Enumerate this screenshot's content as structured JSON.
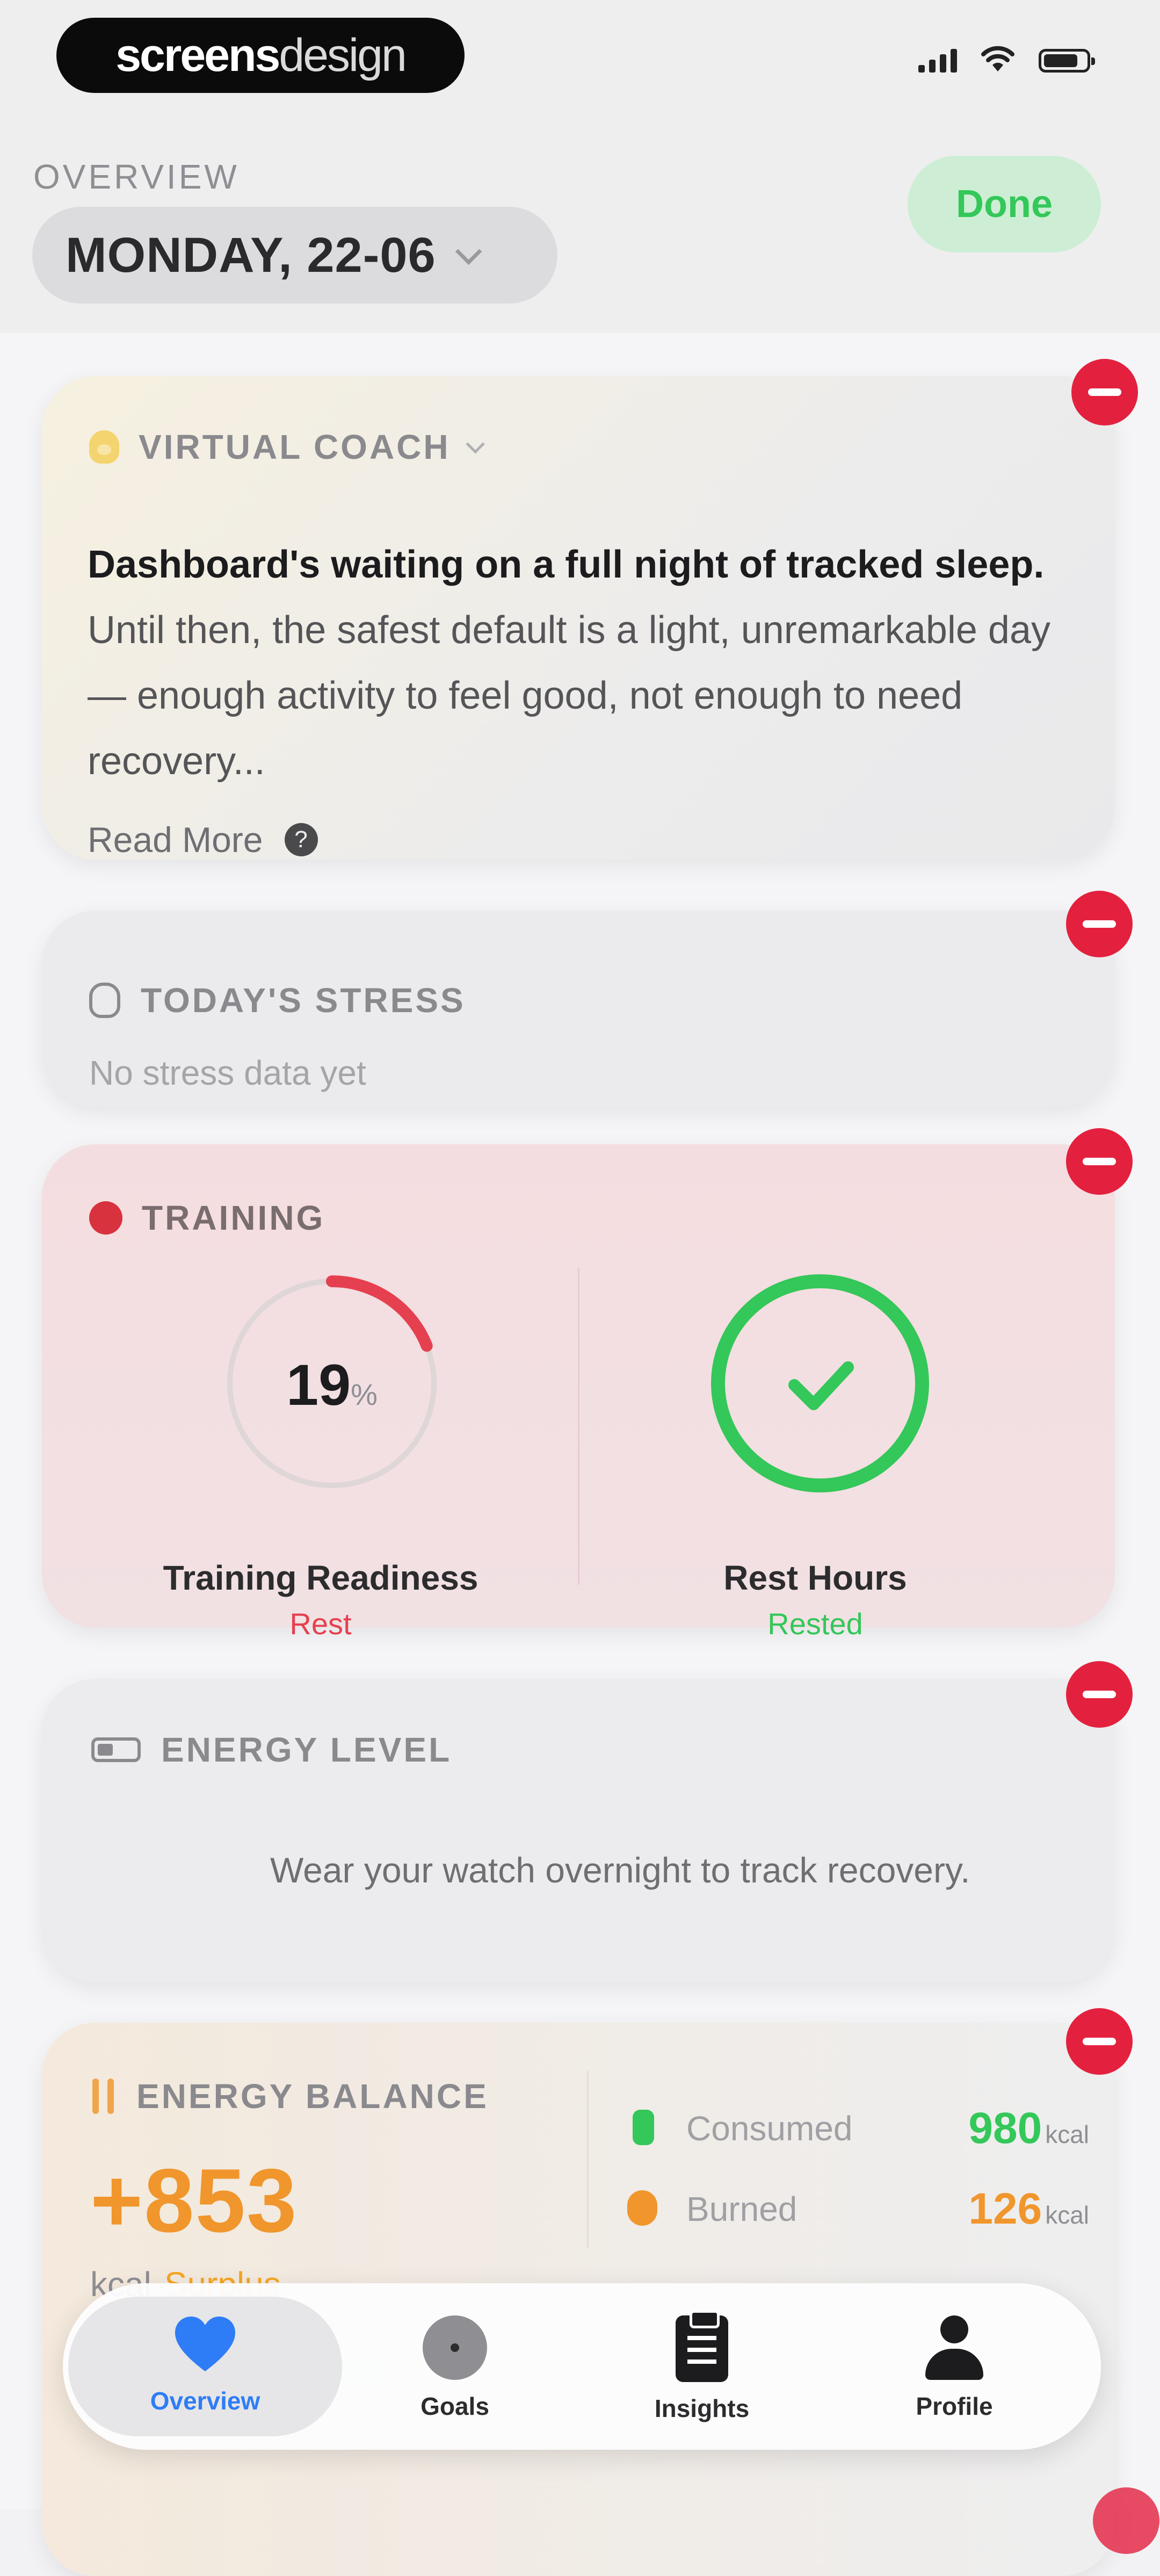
{
  "brand": {
    "bold": "screens",
    "light": "design"
  },
  "header": {
    "overview_label": "OVERVIEW",
    "date": "MONDAY, 22-06",
    "done_label": "Done"
  },
  "coach": {
    "title": "VIRTUAL COACH",
    "bold_text": "Dashboard's waiting on a full night of tracked sleep.",
    "body_text": " Until then, the safest default is a light, unremarkable day — enough activity to feel good, not enough to need recovery...",
    "read_more": "Read More",
    "info_glyph": "?"
  },
  "stress": {
    "title": "TODAY'S STRESS",
    "subtitle": "No stress data yet"
  },
  "training": {
    "title": "TRAINING",
    "readiness": {
      "value": "19",
      "unit": "%",
      "fraction": 0.19,
      "label": "Training Readiness",
      "status": "Rest",
      "color": "#e5404f"
    },
    "rest_hours": {
      "label": "Rest Hours",
      "status": "Rested",
      "color": "#34c759"
    }
  },
  "energy_level": {
    "title": "ENERGY LEVEL",
    "message": "Wear your watch overnight to track recovery."
  },
  "energy_balance": {
    "title": "ENERGY BALANCE",
    "net": "+853",
    "unit": "kcal",
    "state": "Surplus",
    "consumed": {
      "label": "Consumed",
      "value": "980",
      "unit": "kcal",
      "color": "#34c759"
    },
    "burned": {
      "label": "Burned",
      "value": "126",
      "unit": "kcal",
      "color": "#f0962c"
    }
  },
  "tabs": [
    {
      "label": "Overview",
      "icon": "heart-icon",
      "active": true
    },
    {
      "label": "Goals",
      "icon": "goal-icon",
      "active": false
    },
    {
      "label": "Insights",
      "icon": "clipboard-icon",
      "active": false
    },
    {
      "label": "Profile",
      "icon": "person-icon",
      "active": false
    }
  ],
  "colors": {
    "accent_blue": "#2f7df6",
    "remove_red": "#e3213f",
    "done_green": "#34c759",
    "balance_orange": "#f0962c"
  }
}
